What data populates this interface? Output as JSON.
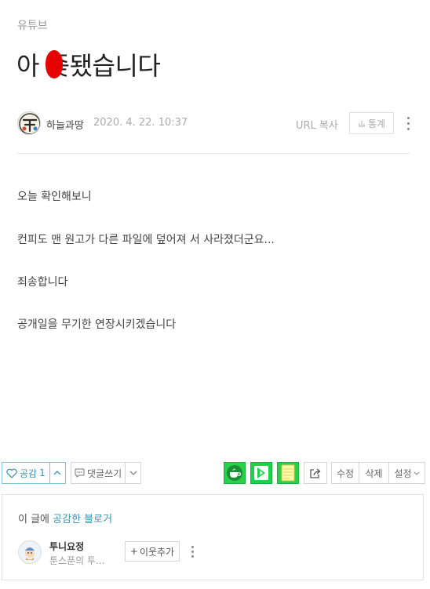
{
  "post": {
    "category": "유튜브",
    "title_before": "아 ",
    "title_redacted": "좆",
    "title_after": "됐습니다",
    "author": "하늘과땅",
    "date": "2020. 4. 22. 10:37",
    "url_copy_label": "URL 복사",
    "stats_label": "통계",
    "paragraphs": [
      "오늘 확인해보니",
      "컨피도 맨 원고가 다른 파일에 덮어져  서 사라졌더군요...",
      "죄송합니다",
      "공개일을 무기한 연장시키겠습니다"
    ]
  },
  "toolbar": {
    "like_label": "공감",
    "like_count": "1",
    "comment_label": "댓글쓰기",
    "edit_label": "수정",
    "delete_label": "삭제",
    "settings_label": "설정"
  },
  "likers": {
    "title_prefix": "이 글에 ",
    "title_accent": "공감한 블로거",
    "items": [
      {
        "name": "투니요정",
        "desc": "툰스푼의 투...",
        "add_label": "이웃추가"
      }
    ]
  },
  "colors": {
    "accent": "#3f94b0",
    "share_green": "#2ad04a",
    "redaction": "#e60000"
  },
  "icons": [
    "heart-icon",
    "chevron-up-icon",
    "speech-bubble-icon",
    "chevron-down-icon",
    "cafe-share-icon",
    "band-share-icon",
    "memo-share-icon",
    "share-icon",
    "bar-chart-icon",
    "more-icon",
    "plus-icon"
  ]
}
